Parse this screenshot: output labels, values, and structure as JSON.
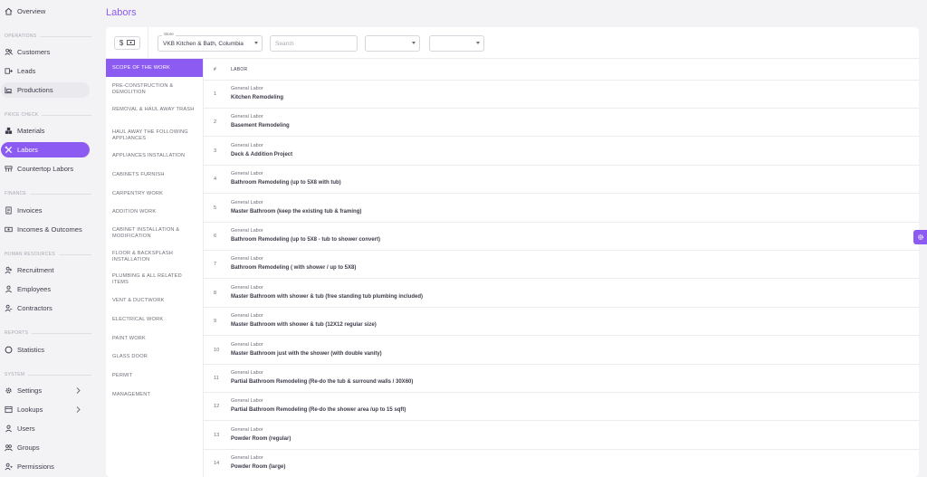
{
  "sidebar": {
    "overview": "Overview",
    "sections": {
      "operations": "OPERATIONS",
      "price_check": "PRICE CHECK",
      "finance": "FINANCE",
      "human_resources": "HUMAN RESOURCES",
      "reports": "REPORTS",
      "system": "SYSTEM"
    },
    "items": {
      "customers": "Customers",
      "leads": "Leads",
      "productions": "Productions",
      "materials": "Materials",
      "labors": "Labors",
      "countertop_labors": "Countertop Labors",
      "invoices": "Invoices",
      "incomes_outcomes": "Incomes & Outcomes",
      "recruitment": "Recruitment",
      "employees": "Employees",
      "contractors": "Contractors",
      "statistics": "Statistics",
      "settings": "Settings",
      "lookups": "Lookups",
      "users": "Users",
      "groups": "Groups",
      "permissions": "Permissions"
    }
  },
  "page": {
    "title": "Labors"
  },
  "toolbar": {
    "currency_symbol": "$",
    "store_label": "Store",
    "store_value": "VKB Kitchen & Bath, Columbia",
    "search_placeholder": "Search"
  },
  "categories": [
    "SCOPE OF THE WORK",
    "PRE-CONSTRUCTION & DEMOLITION",
    "REMOVAL & HAUL AWAY TRASH",
    "HAUL AWAY THE FOLLOWING APPLIANCES",
    "APPLIANCES INSTALLATION",
    "CABINETS FURNISH",
    "CARPENTRY WORK",
    "ADDITION WORK",
    "CABINET INSTALLATION & MODIFICATION",
    "FLOOR & BACKSPLASH INSTALLATION",
    "PLUMBING & ALL RELATED ITEMS",
    "VENT & DUCTWORK",
    "ELECTRICAL WORK",
    "PAINT WORK",
    "GLASS DOOR",
    "PERMIT",
    "MANAGEMENT"
  ],
  "table": {
    "columns": {
      "num": "#",
      "labor": "LABOR"
    },
    "rows": [
      {
        "num": "1",
        "type": "General Labor",
        "name": "Kitchen Remodeling"
      },
      {
        "num": "2",
        "type": "General Labor",
        "name": "Basement Remodeling"
      },
      {
        "num": "3",
        "type": "General Labor",
        "name": "Deck & Addition Project"
      },
      {
        "num": "4",
        "type": "General Labor",
        "name": "Bathroom Remodeling (up to 5X8 with tub)"
      },
      {
        "num": "5",
        "type": "General Labor",
        "name": "Master Bathroom (keep the existing tub & framing)"
      },
      {
        "num": "6",
        "type": "General Labor",
        "name": "Bathroom Remodeling (up to 5X8 - tub to shower convert)"
      },
      {
        "num": "7",
        "type": "General Labor",
        "name": "Bathroom Remodeling ( with shower / up to 5X8)"
      },
      {
        "num": "8",
        "type": "General Labor",
        "name": "Master Bathroom with shower & tub (free standing tub plumbing included)"
      },
      {
        "num": "9",
        "type": "General Labor",
        "name": "Master Bathroom with shower & tub (12X12 regular size)"
      },
      {
        "num": "10",
        "type": "General Labor",
        "name": "Master Bathroom just with the shower (with double vanity)"
      },
      {
        "num": "11",
        "type": "General Labor",
        "name": "Partial Bathroom Remodeling (Re-do the tub & surround walls / 30X60)"
      },
      {
        "num": "12",
        "type": "General Labor",
        "name": "Partial Bathroom Remodeling (Re-do the shower area /up to 15 sqft)"
      },
      {
        "num": "13",
        "type": "General Labor",
        "name": "Powder Room (regular)"
      },
      {
        "num": "14",
        "type": "General Labor",
        "name": "Powder Room (large)"
      }
    ]
  },
  "colors": {
    "accent": "#8c5cf2",
    "background": "#f3f3f6",
    "text": "#3c3c4a"
  }
}
